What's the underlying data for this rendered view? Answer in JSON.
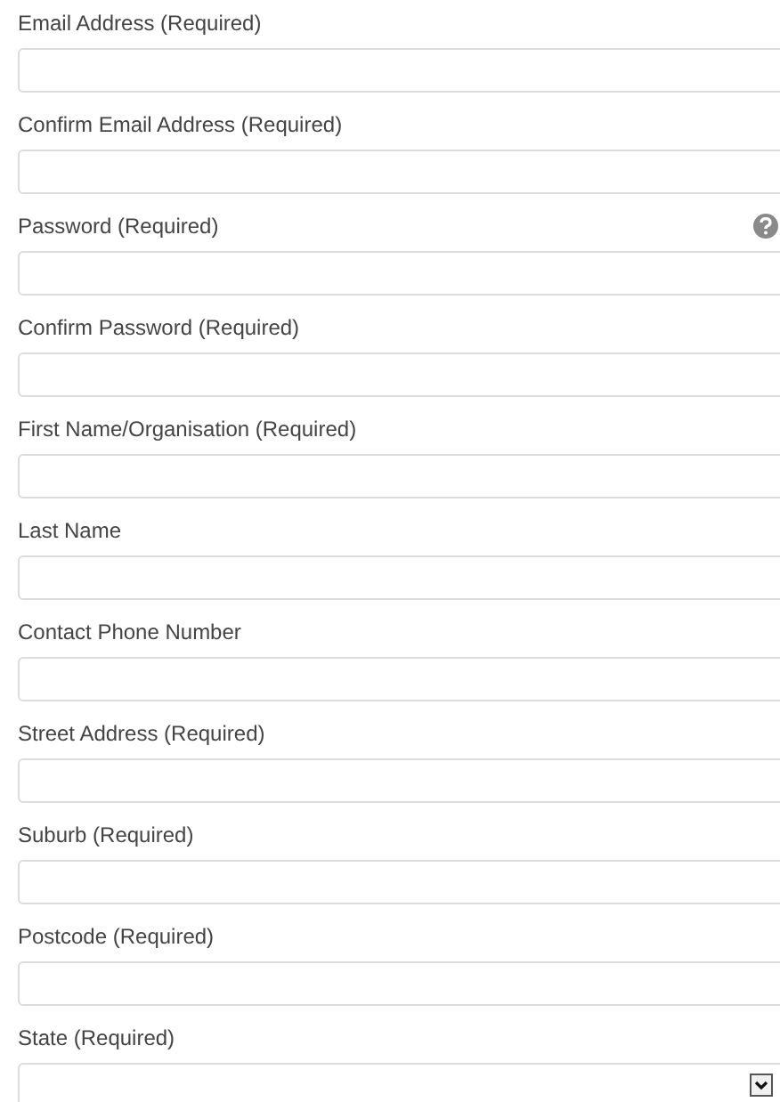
{
  "fields": [
    {
      "label": "Email Address (Required)",
      "kind": "text",
      "help": false
    },
    {
      "label": "Confirm Email Address (Required)",
      "kind": "text",
      "help": false
    },
    {
      "label": "Password (Required)",
      "kind": "password",
      "help": true
    },
    {
      "label": "Confirm Password (Required)",
      "kind": "password",
      "help": false
    },
    {
      "label": "First Name/Organisation (Required)",
      "kind": "text",
      "help": false
    },
    {
      "label": "Last Name",
      "kind": "text",
      "help": false
    },
    {
      "label": "Contact Phone Number",
      "kind": "text",
      "help": false
    },
    {
      "label": "Street Address (Required)",
      "kind": "text",
      "help": false
    },
    {
      "label": "Suburb (Required)",
      "kind": "text",
      "help": false
    },
    {
      "label": "Postcode (Required)",
      "kind": "text",
      "help": false
    },
    {
      "label": "State (Required)",
      "kind": "select",
      "help": false
    }
  ]
}
